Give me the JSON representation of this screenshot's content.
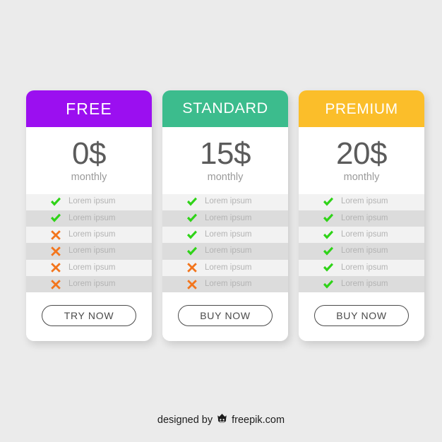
{
  "palette": {
    "page_background": "#ebebeb",
    "card_background": "#ffffff",
    "free_accent": "#9b0ff0",
    "standard_accent": "#3cbc8d",
    "premium_accent": "#fbbe2a",
    "check_color": "#2fd318",
    "cross_color": "#f3751c",
    "row_odd": "#f2f2f2",
    "row_even": "#dcdcdc",
    "feature_text": "#b3b3b3",
    "price_text": "#5b5b5b",
    "period_text": "#9a9a9a",
    "button_text": "#4a4a4a"
  },
  "plans": [
    {
      "id": "free",
      "title": "FREE",
      "accent": "#9b0ff0",
      "price": "0$",
      "period": "monthly",
      "features": [
        {
          "label": "Lorem ipsum",
          "icon": "check-icon",
          "included": true
        },
        {
          "label": "Lorem ipsum",
          "icon": "check-icon",
          "included": true
        },
        {
          "label": "Lorem ipsum",
          "icon": "cross-icon",
          "included": false
        },
        {
          "label": "Lorem ipsum",
          "icon": "cross-icon",
          "included": false
        },
        {
          "label": "Lorem ipsum",
          "icon": "cross-icon",
          "included": false
        },
        {
          "label": "Lorem ipsum",
          "icon": "cross-icon",
          "included": false
        }
      ],
      "cta_label": "TRY NOW"
    },
    {
      "id": "standard",
      "title": "STANDARD",
      "accent": "#3cbc8d",
      "price": "15$",
      "period": "monthly",
      "features": [
        {
          "label": "Lorem ipsum",
          "icon": "check-icon",
          "included": true
        },
        {
          "label": "Lorem ipsum",
          "icon": "check-icon",
          "included": true
        },
        {
          "label": "Lorem ipsum",
          "icon": "check-icon",
          "included": true
        },
        {
          "label": "Lorem ipsum",
          "icon": "check-icon",
          "included": true
        },
        {
          "label": "Lorem ipsum",
          "icon": "cross-icon",
          "included": false
        },
        {
          "label": "Lorem ipsum",
          "icon": "cross-icon",
          "included": false
        }
      ],
      "cta_label": "BUY NOW"
    },
    {
      "id": "premium",
      "title": "PREMIUM",
      "accent": "#fbbe2a",
      "price": "20$",
      "period": "monthly",
      "features": [
        {
          "label": "Lorem ipsum",
          "icon": "check-icon",
          "included": true
        },
        {
          "label": "Lorem ipsum",
          "icon": "check-icon",
          "included": true
        },
        {
          "label": "Lorem ipsum",
          "icon": "check-icon",
          "included": true
        },
        {
          "label": "Lorem ipsum",
          "icon": "check-icon",
          "included": true
        },
        {
          "label": "Lorem ipsum",
          "icon": "check-icon",
          "included": true
        },
        {
          "label": "Lorem ipsum",
          "icon": "check-icon",
          "included": true
        }
      ],
      "cta_label": "BUY NOW"
    }
  ],
  "footer": {
    "credit_text": "designed by",
    "brand": "freepik.com",
    "logo_icon": "freepik-crown-logo"
  }
}
